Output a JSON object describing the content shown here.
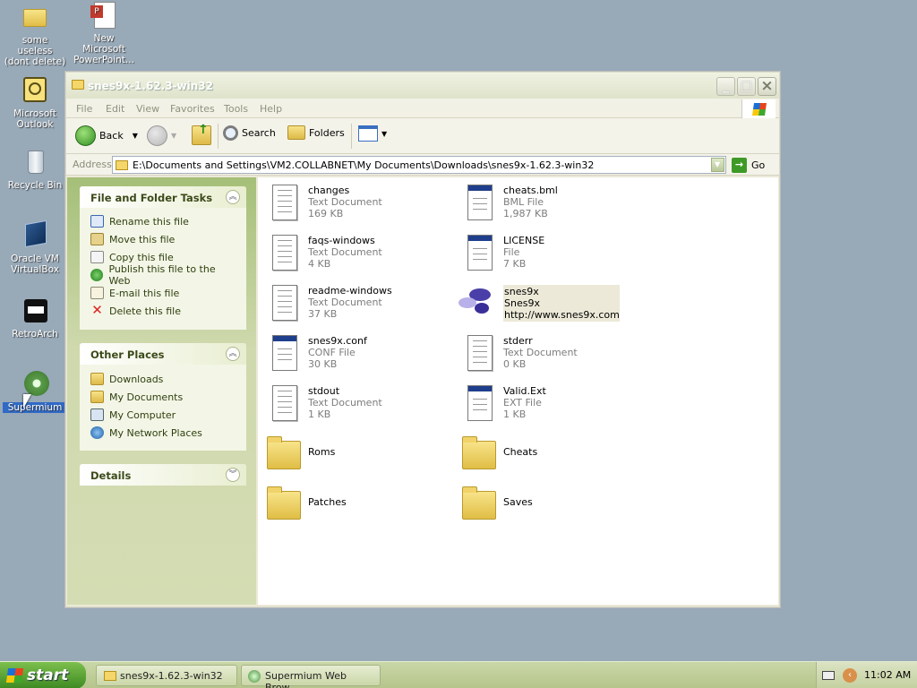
{
  "desktop": {
    "icons": [
      {
        "name": "some useless folder",
        "l1": "some useless",
        "l2": "(dont delete)"
      },
      {
        "name": "powerpoint",
        "l1": "New Microsoft",
        "l2": "PowerPoint..."
      },
      {
        "name": "outlook",
        "l1": "Microsoft",
        "l2": "Outlook"
      },
      {
        "name": "recycle",
        "l1": "Recycle Bin",
        "l2": ""
      },
      {
        "name": "virtualbox",
        "l1": "Oracle VM",
        "l2": "VirtualBox"
      },
      {
        "name": "retroarch",
        "l1": "RetroArch",
        "l2": ""
      },
      {
        "name": "supermium",
        "l1": "Supermium",
        "l2": ""
      }
    ]
  },
  "window": {
    "title": "snes9x-1.62.3-win32",
    "menu": [
      "File",
      "Edit",
      "View",
      "Favorites",
      "Tools",
      "Help"
    ],
    "toolbar": {
      "back": "Back",
      "search": "Search",
      "folders": "Folders"
    },
    "address": {
      "label": "Address",
      "path": "E:\\Documents and Settings\\VM2.COLLABNET\\My Documents\\Downloads\\snes9x-1.62.3-win32",
      "go": "Go"
    }
  },
  "tasks": {
    "title": "File and Folder Tasks",
    "items": [
      "Rename this file",
      "Move this file",
      "Copy this file",
      "Publish this file to the Web",
      "E-mail this file",
      "Delete this file"
    ]
  },
  "places": {
    "title": "Other Places",
    "items": [
      "Downloads",
      "My Documents",
      "My Computer",
      "My Network Places"
    ]
  },
  "details": {
    "title": "Details"
  },
  "files": [
    {
      "name": "changes",
      "type": "Text Document",
      "size": "169 KB"
    },
    {
      "name": "cheats.bml",
      "type": "BML File",
      "size": "1,987 KB"
    },
    {
      "name": "faqs-windows",
      "type": "Text Document",
      "size": "4 KB"
    },
    {
      "name": "LICENSE",
      "type": "File",
      "size": "7 KB"
    },
    {
      "name": "readme-windows",
      "type": "Text Document",
      "size": "37 KB"
    },
    {
      "name": "snes9x",
      "type": "Snes9x",
      "size": "http://www.snes9x.com"
    },
    {
      "name": "snes9x.conf",
      "type": "CONF File",
      "size": "30 KB"
    },
    {
      "name": "stderr",
      "type": "Text Document",
      "size": "0 KB"
    },
    {
      "name": "stdout",
      "type": "Text Document",
      "size": "1 KB"
    },
    {
      "name": "Valid.Ext",
      "type": "EXT File",
      "size": "1 KB"
    },
    {
      "name": "Roms",
      "type": "",
      "size": ""
    },
    {
      "name": "Cheats",
      "type": "",
      "size": ""
    },
    {
      "name": "Patches",
      "type": "",
      "size": ""
    },
    {
      "name": "Saves",
      "type": "",
      "size": ""
    }
  ],
  "taskbar": {
    "start": "start",
    "tasks": [
      "snes9x-1.62.3-win32",
      "Supermium Web Brow..."
    ],
    "clock": "11:02 AM"
  }
}
